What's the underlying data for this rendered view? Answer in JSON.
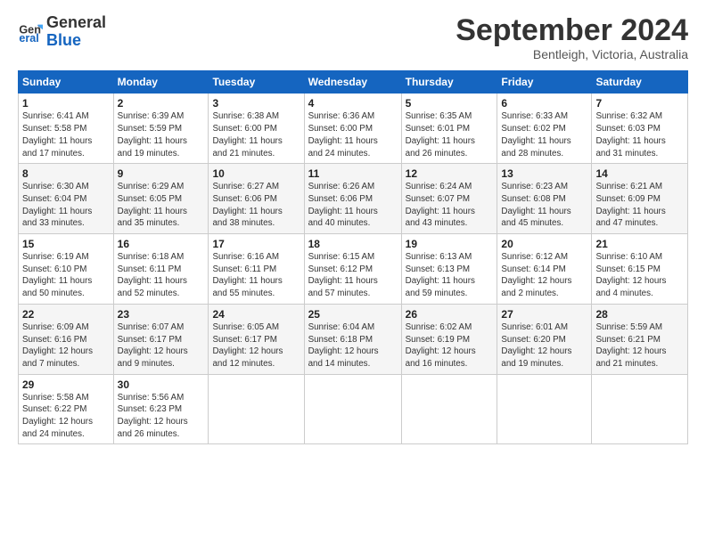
{
  "header": {
    "logo_line1": "General",
    "logo_line2": "Blue",
    "month_title": "September 2024",
    "location": "Bentleigh, Victoria, Australia"
  },
  "weekdays": [
    "Sunday",
    "Monday",
    "Tuesday",
    "Wednesday",
    "Thursday",
    "Friday",
    "Saturday"
  ],
  "weeks": [
    [
      {
        "day": "1",
        "info": "Sunrise: 6:41 AM\nSunset: 5:58 PM\nDaylight: 11 hours\nand 17 minutes."
      },
      {
        "day": "2",
        "info": "Sunrise: 6:39 AM\nSunset: 5:59 PM\nDaylight: 11 hours\nand 19 minutes."
      },
      {
        "day": "3",
        "info": "Sunrise: 6:38 AM\nSunset: 6:00 PM\nDaylight: 11 hours\nand 21 minutes."
      },
      {
        "day": "4",
        "info": "Sunrise: 6:36 AM\nSunset: 6:00 PM\nDaylight: 11 hours\nand 24 minutes."
      },
      {
        "day": "5",
        "info": "Sunrise: 6:35 AM\nSunset: 6:01 PM\nDaylight: 11 hours\nand 26 minutes."
      },
      {
        "day": "6",
        "info": "Sunrise: 6:33 AM\nSunset: 6:02 PM\nDaylight: 11 hours\nand 28 minutes."
      },
      {
        "day": "7",
        "info": "Sunrise: 6:32 AM\nSunset: 6:03 PM\nDaylight: 11 hours\nand 31 minutes."
      }
    ],
    [
      {
        "day": "8",
        "info": "Sunrise: 6:30 AM\nSunset: 6:04 PM\nDaylight: 11 hours\nand 33 minutes."
      },
      {
        "day": "9",
        "info": "Sunrise: 6:29 AM\nSunset: 6:05 PM\nDaylight: 11 hours\nand 35 minutes."
      },
      {
        "day": "10",
        "info": "Sunrise: 6:27 AM\nSunset: 6:06 PM\nDaylight: 11 hours\nand 38 minutes."
      },
      {
        "day": "11",
        "info": "Sunrise: 6:26 AM\nSunset: 6:06 PM\nDaylight: 11 hours\nand 40 minutes."
      },
      {
        "day": "12",
        "info": "Sunrise: 6:24 AM\nSunset: 6:07 PM\nDaylight: 11 hours\nand 43 minutes."
      },
      {
        "day": "13",
        "info": "Sunrise: 6:23 AM\nSunset: 6:08 PM\nDaylight: 11 hours\nand 45 minutes."
      },
      {
        "day": "14",
        "info": "Sunrise: 6:21 AM\nSunset: 6:09 PM\nDaylight: 11 hours\nand 47 minutes."
      }
    ],
    [
      {
        "day": "15",
        "info": "Sunrise: 6:19 AM\nSunset: 6:10 PM\nDaylight: 11 hours\nand 50 minutes."
      },
      {
        "day": "16",
        "info": "Sunrise: 6:18 AM\nSunset: 6:11 PM\nDaylight: 11 hours\nand 52 minutes."
      },
      {
        "day": "17",
        "info": "Sunrise: 6:16 AM\nSunset: 6:11 PM\nDaylight: 11 hours\nand 55 minutes."
      },
      {
        "day": "18",
        "info": "Sunrise: 6:15 AM\nSunset: 6:12 PM\nDaylight: 11 hours\nand 57 minutes."
      },
      {
        "day": "19",
        "info": "Sunrise: 6:13 AM\nSunset: 6:13 PM\nDaylight: 11 hours\nand 59 minutes."
      },
      {
        "day": "20",
        "info": "Sunrise: 6:12 AM\nSunset: 6:14 PM\nDaylight: 12 hours\nand 2 minutes."
      },
      {
        "day": "21",
        "info": "Sunrise: 6:10 AM\nSunset: 6:15 PM\nDaylight: 12 hours\nand 4 minutes."
      }
    ],
    [
      {
        "day": "22",
        "info": "Sunrise: 6:09 AM\nSunset: 6:16 PM\nDaylight: 12 hours\nand 7 minutes."
      },
      {
        "day": "23",
        "info": "Sunrise: 6:07 AM\nSunset: 6:17 PM\nDaylight: 12 hours\nand 9 minutes."
      },
      {
        "day": "24",
        "info": "Sunrise: 6:05 AM\nSunset: 6:17 PM\nDaylight: 12 hours\nand 12 minutes."
      },
      {
        "day": "25",
        "info": "Sunrise: 6:04 AM\nSunset: 6:18 PM\nDaylight: 12 hours\nand 14 minutes."
      },
      {
        "day": "26",
        "info": "Sunrise: 6:02 AM\nSunset: 6:19 PM\nDaylight: 12 hours\nand 16 minutes."
      },
      {
        "day": "27",
        "info": "Sunrise: 6:01 AM\nSunset: 6:20 PM\nDaylight: 12 hours\nand 19 minutes."
      },
      {
        "day": "28",
        "info": "Sunrise: 5:59 AM\nSunset: 6:21 PM\nDaylight: 12 hours\nand 21 minutes."
      }
    ],
    [
      {
        "day": "29",
        "info": "Sunrise: 5:58 AM\nSunset: 6:22 PM\nDaylight: 12 hours\nand 24 minutes."
      },
      {
        "day": "30",
        "info": "Sunrise: 5:56 AM\nSunset: 6:23 PM\nDaylight: 12 hours\nand 26 minutes."
      },
      null,
      null,
      null,
      null,
      null
    ]
  ]
}
